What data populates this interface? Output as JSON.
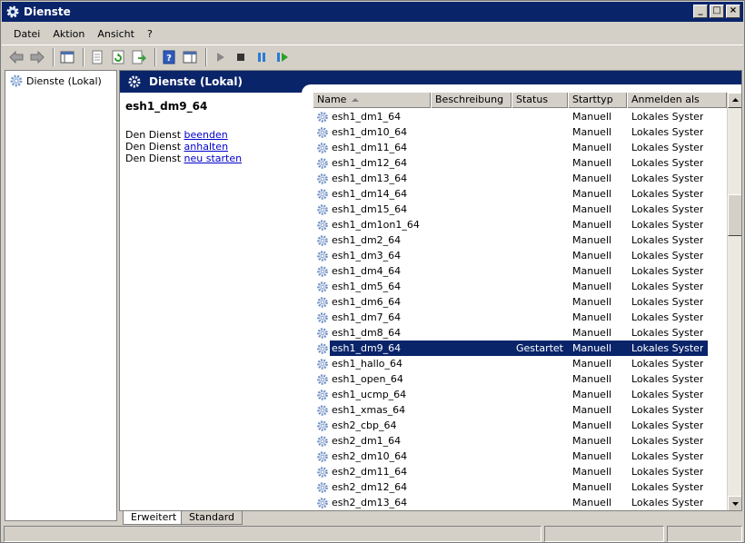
{
  "window": {
    "title": "Dienste",
    "buttons": {
      "minimize": "_",
      "maximize": "□",
      "close": "×"
    }
  },
  "menu": [
    "Datei",
    "Aktion",
    "Ansicht",
    "?"
  ],
  "tree": {
    "root_label": "Dienste (Lokal)"
  },
  "banner": {
    "title": "Dienste (Lokal)"
  },
  "details": {
    "service_name": "esh1_dm9_64",
    "prefix": "Den Dienst",
    "actions": [
      "beenden",
      "anhalten",
      "neu starten"
    ]
  },
  "list": {
    "columns": [
      "Name",
      "Beschreibung",
      "Status",
      "Starttyp",
      "Anmelden als"
    ],
    "rows": [
      {
        "name": "esh1_dm1_64",
        "desc": "",
        "status": "",
        "start": "Manuell",
        "logon": "Lokales System"
      },
      {
        "name": "esh1_dm10_64",
        "desc": "",
        "status": "",
        "start": "Manuell",
        "logon": "Lokales System"
      },
      {
        "name": "esh1_dm11_64",
        "desc": "",
        "status": "",
        "start": "Manuell",
        "logon": "Lokales System"
      },
      {
        "name": "esh1_dm12_64",
        "desc": "",
        "status": "",
        "start": "Manuell",
        "logon": "Lokales System"
      },
      {
        "name": "esh1_dm13_64",
        "desc": "",
        "status": "",
        "start": "Manuell",
        "logon": "Lokales System"
      },
      {
        "name": "esh1_dm14_64",
        "desc": "",
        "status": "",
        "start": "Manuell",
        "logon": "Lokales System"
      },
      {
        "name": "esh1_dm15_64",
        "desc": "",
        "status": "",
        "start": "Manuell",
        "logon": "Lokales System"
      },
      {
        "name": "esh1_dm1on1_64",
        "desc": "",
        "status": "",
        "start": "Manuell",
        "logon": "Lokales System"
      },
      {
        "name": "esh1_dm2_64",
        "desc": "",
        "status": "",
        "start": "Manuell",
        "logon": "Lokales System"
      },
      {
        "name": "esh1_dm3_64",
        "desc": "",
        "status": "",
        "start": "Manuell",
        "logon": "Lokales System"
      },
      {
        "name": "esh1_dm4_64",
        "desc": "",
        "status": "",
        "start": "Manuell",
        "logon": "Lokales System"
      },
      {
        "name": "esh1_dm5_64",
        "desc": "",
        "status": "",
        "start": "Manuell",
        "logon": "Lokales System"
      },
      {
        "name": "esh1_dm6_64",
        "desc": "",
        "status": "",
        "start": "Manuell",
        "logon": "Lokales System"
      },
      {
        "name": "esh1_dm7_64",
        "desc": "",
        "status": "",
        "start": "Manuell",
        "logon": "Lokales System"
      },
      {
        "name": "esh1_dm8_64",
        "desc": "",
        "status": "",
        "start": "Manuell",
        "logon": "Lokales System"
      },
      {
        "name": "esh1_dm9_64",
        "desc": "",
        "status": "Gestartet",
        "start": "Manuell",
        "logon": "Lokales System",
        "selected": true
      },
      {
        "name": "esh1_hallo_64",
        "desc": "",
        "status": "",
        "start": "Manuell",
        "logon": "Lokales System"
      },
      {
        "name": "esh1_open_64",
        "desc": "",
        "status": "",
        "start": "Manuell",
        "logon": "Lokales System"
      },
      {
        "name": "esh1_ucmp_64",
        "desc": "",
        "status": "",
        "start": "Manuell",
        "logon": "Lokales System"
      },
      {
        "name": "esh1_xmas_64",
        "desc": "",
        "status": "",
        "start": "Manuell",
        "logon": "Lokales System"
      },
      {
        "name": "esh2_cbp_64",
        "desc": "",
        "status": "",
        "start": "Manuell",
        "logon": "Lokales System"
      },
      {
        "name": "esh2_dm1_64",
        "desc": "",
        "status": "",
        "start": "Manuell",
        "logon": "Lokales System"
      },
      {
        "name": "esh2_dm10_64",
        "desc": "",
        "status": "",
        "start": "Manuell",
        "logon": "Lokales System"
      },
      {
        "name": "esh2_dm11_64",
        "desc": "",
        "status": "",
        "start": "Manuell",
        "logon": "Lokales System"
      },
      {
        "name": "esh2_dm12_64",
        "desc": "",
        "status": "",
        "start": "Manuell",
        "logon": "Lokales System"
      },
      {
        "name": "esh2_dm13_64",
        "desc": "",
        "status": "",
        "start": "Manuell",
        "logon": "Lokales System"
      }
    ]
  },
  "view_tabs": [
    "Erweitert",
    "Standard"
  ],
  "colors": {
    "title_bg": "#0a246a",
    "chrome": "#d4d0c8",
    "link": "#0000cc",
    "selection": "#0a246a"
  }
}
